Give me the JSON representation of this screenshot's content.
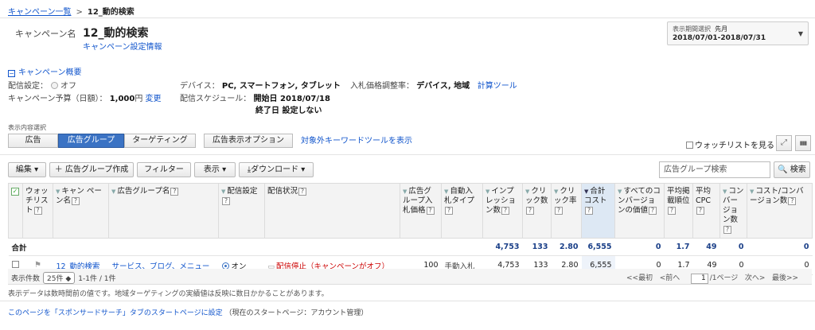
{
  "breadcrumb": {
    "parent": "キャンペーン一覧",
    "separator": ">",
    "current": "12_動的検索"
  },
  "campaign": {
    "label": "キャンペーン名",
    "name": "12_動的検索",
    "settings_link": "キャンペーン設定情報"
  },
  "period": {
    "label": "表示期間選択",
    "value_label": "先月",
    "range": "2018/07/01-2018/07/31",
    "arrow": "▼"
  },
  "summary": {
    "toggle_icon": "−",
    "toggle_label": "キャンペーン概要",
    "delivery_label": "配信設定：",
    "delivery_value": "オフ",
    "budget_label": "キャンペーン予算（日額）：",
    "budget_value": "1,000",
    "budget_unit": "円",
    "budget_change": "変更",
    "device_label": "デバイス：",
    "device_value": "PC, スマートフォン, タブレット",
    "schedule_label": "配信スケジュール：",
    "schedule_start": "開始日 2018/07/18",
    "schedule_end": "終了日 設定しない",
    "bid_label": "入札価格調整率：",
    "bid_value": "デバイス, 地域",
    "bid_tool": "計算ツール"
  },
  "view": {
    "label": "表示内容選択",
    "tabs": [
      "広告",
      "広告グループ",
      "ターゲティング"
    ],
    "options_tab": "広告表示オプション",
    "kw_tool": "対象外キーワードツールを表示",
    "watchlist": "ウォッチリストを見る",
    "expand_icon": "⤢",
    "chart_icon": "▮▮▮"
  },
  "toolbar": {
    "edit": "編集 ▾",
    "create": "＋ 広告グループ作成",
    "filter": "フィルター",
    "display": "表示 ▾",
    "download": "⤓ダウンロード ▾",
    "search_placeholder": "広告グループ検索",
    "search_button": "🔍 検索"
  },
  "table": {
    "headers": {
      "watch": "ウォッ チリスト",
      "campaign": "キャン ペーン名",
      "adgroup": "広告グループ名",
      "delivery": "配信設定",
      "status": "配信状況",
      "bid": "広告グループ入札価格",
      "auto_bid": "自動入札タイプ",
      "impressions": "インプレッション数",
      "clicks": "クリック数",
      "ctr": "クリック率",
      "cost": "合計コスト",
      "all_conv_value": "すべてのコンバージョンの価値",
      "avg_position": "平均掲載順位",
      "avg_cpc": "平均CPC",
      "conversions": "コンバージョン数",
      "cost_per_conv": "コスト/コンバージョン数"
    },
    "total": {
      "label": "合計",
      "impressions": "4,753",
      "clicks": "133",
      "ctr": "2.80",
      "cost": "6,555",
      "all_conv_value": "0",
      "avg_position": "1.7",
      "avg_cpc": "49",
      "conversions": "0",
      "cost_per_conv": "0"
    },
    "rows": [
      {
        "campaign": "12_動的検索",
        "adgroup": "サービス、ブログ、メニュー",
        "delivery": "オン",
        "status": "配信停止（キャンペーンがオフ）",
        "bid": "100",
        "auto_bid": "手動入札",
        "impressions": "4,753",
        "clicks": "133",
        "ctr": "2.80",
        "cost": "6,555",
        "all_conv_value": "0",
        "avg_position": "1.7",
        "avg_cpc": "49",
        "conversions": "0",
        "cost_per_conv": "0"
      }
    ]
  },
  "pager": {
    "count_label": "表示件数",
    "page_size": "25件 ◆",
    "range": "1-1件 / 1件",
    "first": "<<最初",
    "prev": "<前へ",
    "page": "1",
    "of": "/1ページ",
    "next": "次へ>",
    "last": "最後>>"
  },
  "note": "表示データは数時間前の値です。地域ターゲティングの実績値は反映に数日かかることがあります。",
  "footer": {
    "link": "このページを「スポンサードサーチ」タブのスタートページに設定",
    "current": "（現在のスタートページ：アカウント管理）"
  }
}
